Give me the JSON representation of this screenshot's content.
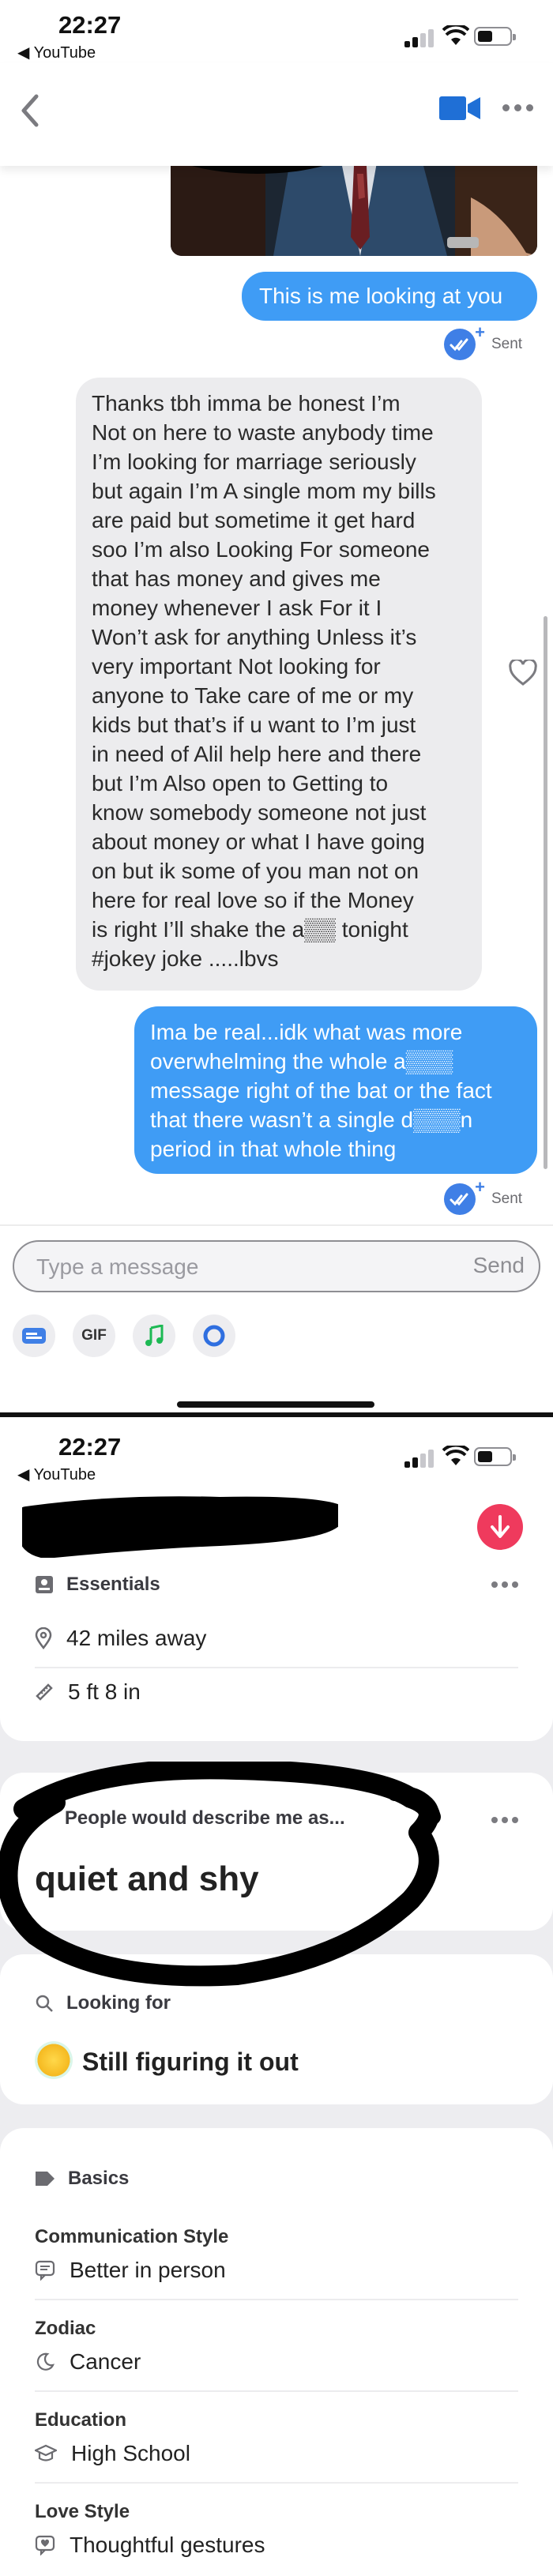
{
  "status": {
    "time": "22:27",
    "back_app": "◀ YouTube"
  },
  "chat": {
    "messages": [
      {
        "from": "me",
        "text": "This is me looking at you",
        "status": "Sent"
      },
      {
        "from": "them",
        "text": "Thanks tbh  imma be honest  I’m\nNot on here to waste anybody time\nI’m looking for marriage seriously\nbut again I’m A single mom my bills\nare paid but sometime it get hard\nsoo I’m also Looking For someone\nthat has money  and gives me\nmoney whenever I ask For it I\nWon’t ask for anything  Unless it’s\nvery important   Not looking  for\nanyone to Take care of me or my\nkids but that’s if u want to I’m just\nin need of   Alil help here and there\nbut I’m Also open to Getting to\nknow somebody someone not just\nabout money or what I have going\non  but ik some  of you man not on\nhere for real love so if the   Money\nis right I’ll shake the a▒▒ tonight\n#jokey joke .....lbvs"
      },
      {
        "from": "me",
        "text": "Ima be real...idk what was more\noverwhelming the whole a▒▒▒\nmessage right of the bat or the fact\nthat there wasn’t a single d▒▒▒n\nperiod in that whole thing",
        "status": "Sent"
      }
    ],
    "composer": {
      "placeholder": "Type a message",
      "send_label": "Send"
    },
    "tools": {
      "gif_label": "GIF"
    }
  },
  "profile": {
    "status_time": "22:27",
    "back_app": "◀ YouTube",
    "essentials": {
      "title": "Essentials",
      "distance": "42 miles away",
      "height": "5 ft 8 in"
    },
    "prompt": {
      "title": "People would describe me as...",
      "answer": "quiet and shy"
    },
    "looking_for": {
      "title": "Looking for",
      "value": "Still figuring it out"
    },
    "basics": {
      "title": "Basics",
      "items": [
        {
          "label": "Communication Style",
          "value": "Better in person",
          "icon": "speech-bubble-icon"
        },
        {
          "label": "Zodiac",
          "value": "Cancer",
          "icon": "moon-icon"
        },
        {
          "label": "Education",
          "value": "High School",
          "icon": "graduation-cap-icon"
        },
        {
          "label": "Love Style",
          "value": "Thoughtful gestures",
          "icon": "heart-bubble-icon"
        }
      ]
    }
  },
  "colors": {
    "accent_blue": "#3f9cf5",
    "bubble_gray": "#ececee",
    "brand_red": "#ef3a5d"
  }
}
